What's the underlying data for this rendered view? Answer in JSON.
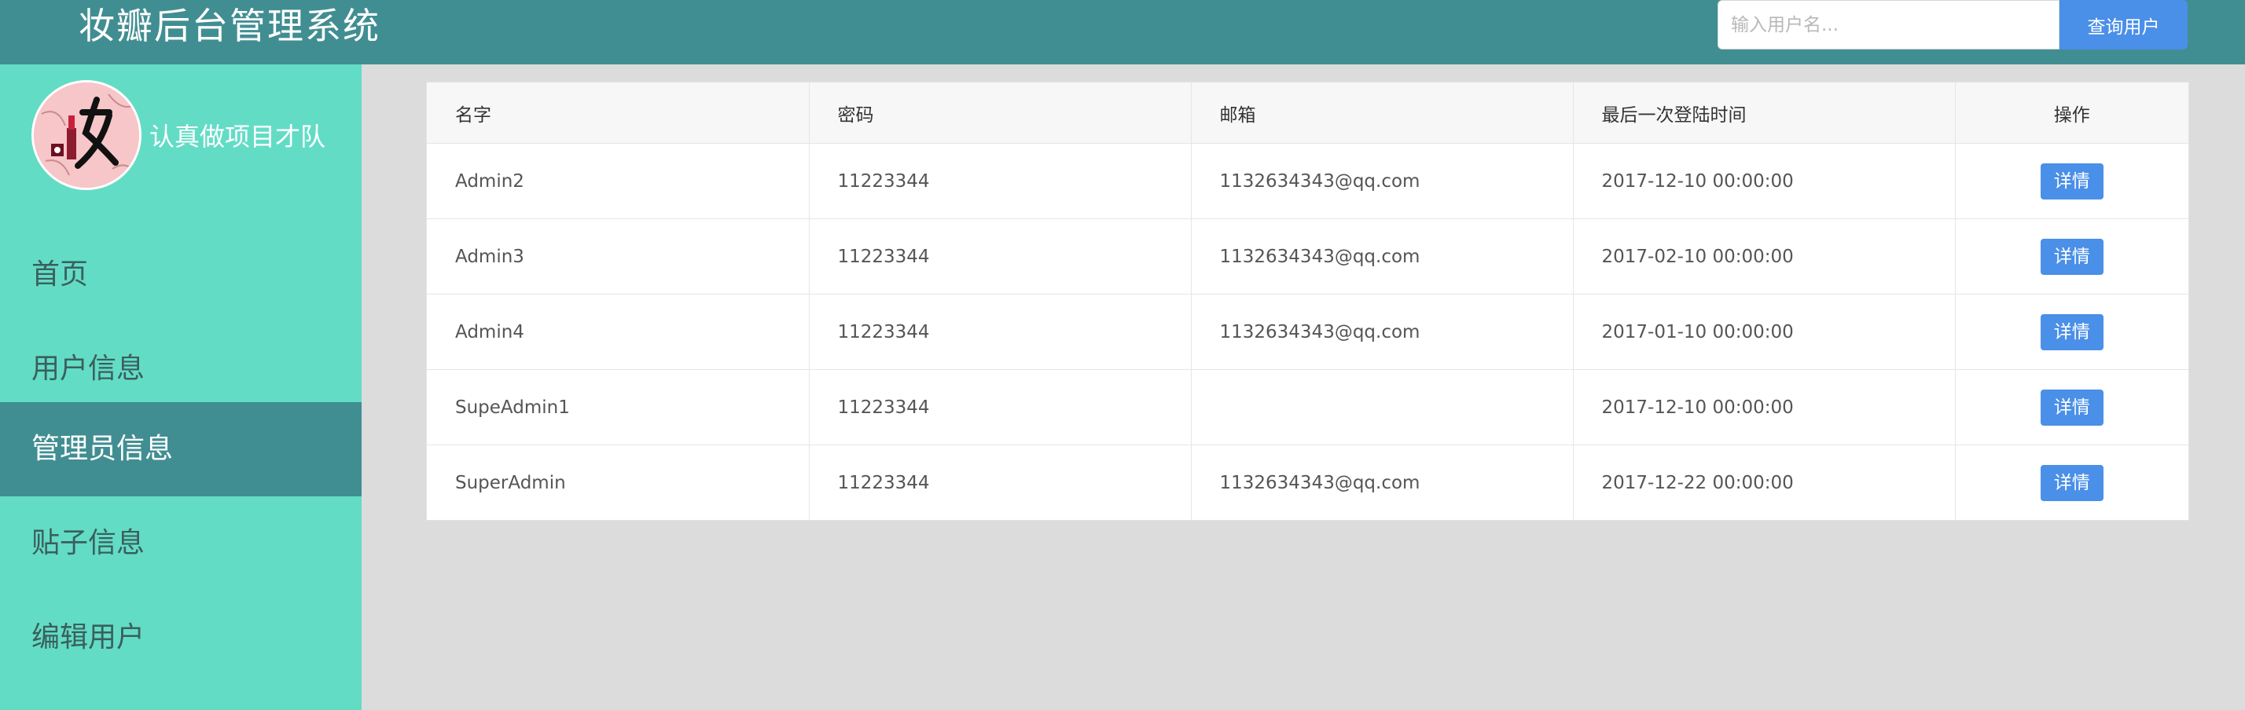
{
  "header": {
    "title": "妆瓣后台管理系统",
    "search_placeholder": "输入用户名...",
    "search_value": "",
    "search_button": "查询用户"
  },
  "sidebar": {
    "team_name": "认真做项目才队",
    "logo_icon": "makeup-logo-icon",
    "items": [
      {
        "label": "首页",
        "active": false
      },
      {
        "label": "用户信息",
        "active": false
      },
      {
        "label": "管理员信息",
        "active": true
      },
      {
        "label": "贴子信息",
        "active": false
      },
      {
        "label": "编辑用户",
        "active": false
      }
    ]
  },
  "table": {
    "columns": [
      "名字",
      "密码",
      "邮箱",
      "最后一次登陆时间",
      "操作"
    ],
    "rows": [
      {
        "name": "Admin2",
        "password": "11223344",
        "email": "1132634343@qq.com",
        "last_login": "2017-12-10 00:00:00",
        "action": "详情"
      },
      {
        "name": "Admin3",
        "password": "11223344",
        "email": "1132634343@qq.com",
        "last_login": "2017-02-10 00:00:00",
        "action": "详情"
      },
      {
        "name": "Admin4",
        "password": "11223344",
        "email": "1132634343@qq.com",
        "last_login": "2017-01-10 00:00:00",
        "action": "详情"
      },
      {
        "name": "SupeAdmin1",
        "password": "11223344",
        "email": "",
        "last_login": "2017-12-10 00:00:00",
        "action": "详情"
      },
      {
        "name": "SuperAdmin",
        "password": "11223344",
        "email": "1132634343@qq.com",
        "last_login": "2017-12-22 00:00:00",
        "action": "详情"
      }
    ]
  },
  "colors": {
    "header_bg": "#418e92",
    "sidebar_bg": "#63dcc6",
    "sidebar_active_bg": "#418e92",
    "content_bg": "#dcdcdc",
    "primary_button": "#4a8fe8"
  }
}
